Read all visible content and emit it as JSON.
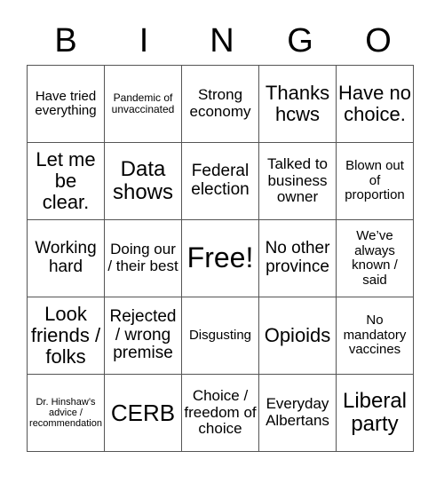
{
  "header": {
    "letters": [
      "B",
      "I",
      "N",
      "G",
      "O"
    ]
  },
  "grid": {
    "rows": [
      [
        "Have tried everything",
        "Pandemic of unvaccinated",
        "Strong economy",
        "Thanks hcws",
        "Have no choice."
      ],
      [
        "Let me be clear.",
        "Data shows",
        "Federal election",
        "Talked to business owner",
        "Blown out of proportion"
      ],
      [
        "Working hard",
        "Doing our / their best",
        "Free!",
        "No other province",
        "We’ve always known / said"
      ],
      [
        "Look friends / folks",
        "Rejected / wrong premise",
        "Disgusting",
        "Opioids",
        "No mandatory vaccines"
      ],
      [
        "Dr. Hinshaw’s advice / recommendation",
        "CERB",
        "Choice / freedom of choice",
        "Everyday Albertans",
        "Liberal party"
      ]
    ]
  }
}
